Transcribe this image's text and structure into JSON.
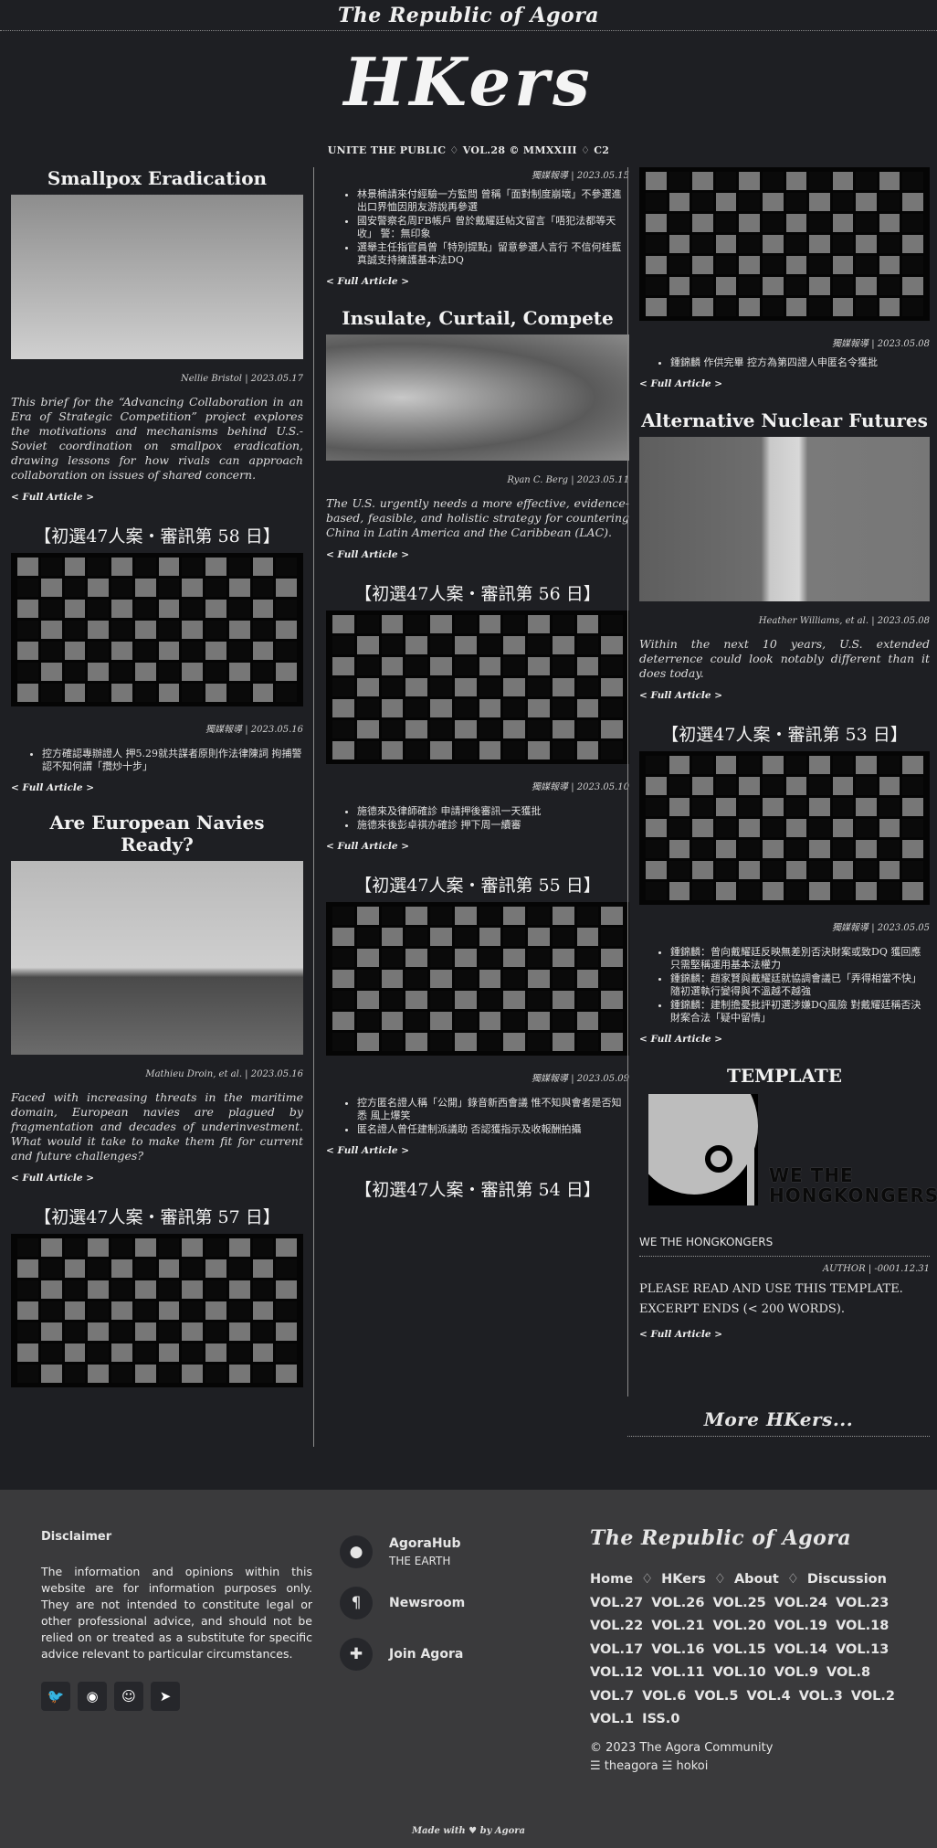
{
  "top_title": "The Republic of Agora",
  "masthead": {
    "logo": "HKers",
    "subtitle": "UNITE THE PUBLIC ♢ VOL.28 © MMXXIII ♢ C2"
  },
  "full_article": "< Full Article >",
  "col1": {
    "a1": {
      "title": "Smallpox Eradication",
      "byline": "Nellie Bristol | 2023.05.17",
      "lede": "This brief for the “Advancing Collaboration in an Era of Strategic Competition” project explores the motivations and mechanisms behind U.S.-Soviet coordination on smallpox eradication, drawing lessons for how rivals can approach collaboration on issues of shared concern."
    },
    "a2": {
      "title": "【初選47人案・審訊第 58 日】",
      "byline": "獨媒報導 | 2023.05.16",
      "bullets": [
        "控方確認專辦證人 押5.29就共謀者原則作法律陳詞 拘捕警認不知何謂「攬炒十步」"
      ]
    },
    "a3": {
      "title": "Are European Navies Ready?",
      "byline": "Mathieu Droin, et al. | 2023.05.16",
      "lede": "Faced with increasing threats in the maritime domain, European navies are plagued by fragmentation and decades of underinvestment. What would it take to make them fit for current and future challenges?"
    },
    "a4": {
      "title": "【初選47人案・審訊第 57 日】"
    }
  },
  "col2": {
    "top": {
      "byline": "獨媒報導 | 2023.05.15",
      "bullets": [
        "林景楠請來付經驗一方監問 曾稱「面對制度崩壞」不參選進出口界恤因朋友游說再參選",
        "國安警察名周FB帳戶 曾於戴耀廷帖文留言「唔犯法都等天收」 警：無印象",
        "選舉主任指官員曾「特別提點」留意參選人言行 不信何桂藍真誠支持擁護基本法DQ"
      ]
    },
    "a1": {
      "title": "Insulate, Curtail, Compete",
      "byline": "Ryan C. Berg | 2023.05.11",
      "lede": "The U.S. urgently needs a more effective, evidence-based, feasible, and holistic strategy for countering China in Latin America and the Caribbean (LAC)."
    },
    "a2": {
      "title": "【初選47人案・審訊第 56 日】",
      "byline": "獨媒報導 | 2023.05.10",
      "bullets": [
        "施德來及律師確診 申請押後審訊一天獲批",
        "施德來後彭卓祺亦確診 押下周一續審"
      ]
    },
    "a3": {
      "title": "【初選47人案・審訊第 55 日】",
      "byline": "獨媒報導 | 2023.05.09",
      "bullets": [
        "控方匿名證人稱「公開」錄音新西會議 惟不知與會者是否知悉 風上爆笑",
        "匿名證人曾任建制派議助 否認獲指示及收報酬拍攝"
      ]
    },
    "a4": {
      "title": "【初選47人案・審訊第 54 日】"
    }
  },
  "col3": {
    "top": {
      "byline": "獨媒報導 | 2023.05.08",
      "bullets": [
        "鍾錦麟 作供完畢 控方為第四證人申匿名令獲批"
      ]
    },
    "a1": {
      "title": "Alternative Nuclear Futures",
      "byline": "Heather Williams, et al. | 2023.05.08",
      "lede": "Within the next 10 years, U.S. extended deterrence could look notably different than it does today."
    },
    "a2": {
      "title": "【初選47人案・審訊第 53 日】",
      "byline": "獨媒報導 | 2023.05.05",
      "bullets": [
        "鍾錦麟：曾向戴耀廷反映無差別否決財案或致DQ 獲回應只需堅稱運用基本法權力",
        "鍾錦麟：趙家賢與戴耀廷就協調會議已「弄得相當不快」 隨初選執行變得與不溫越不越強",
        "鍾錦麟：建制擔憂批評初選涉嫌DQ風險 對戴耀廷稱否決財案合法「疑中留情」"
      ]
    },
    "a3": {
      "title": "TEMPLATE",
      "logo_text": "WE THE HONGKONGERS",
      "name": "WE THE HONGKONGERS",
      "byline": "AUTHOR | -0001.12.31",
      "body": "PLEASE READ AND USE THIS TEMPLATE. EXCERPT ENDS (< 200 WORDS)."
    },
    "more": "More HKers..."
  },
  "footer": {
    "disclaimer_title": "Disclaimer",
    "disclaimer": "The information and opinions within this website are for information purposes only. They are not intended to constitute legal or other professional advice, and should not be relied on or treated as a substitute for specific advice relevant to particular circumstances.",
    "social_icons": [
      "twitter-icon",
      "github-icon",
      "reddit-icon",
      "telegram-icon"
    ],
    "links": [
      {
        "title": "AgoraHub",
        "sub": "THE EARTH",
        "icon": "map-pin-icon"
      },
      {
        "title": "Newsroom",
        "sub": "",
        "icon": "paragraph-icon"
      },
      {
        "title": "Join Agora",
        "sub": "",
        "icon": "puzzle-icon"
      }
    ],
    "brand": "The Republic of Agora",
    "nav_rows": [
      "Home ♢ HKers ♢ About ♢ Discussion",
      "VOL.27  VOL.26  VOL.25  VOL.24  VOL.23",
      "VOL.22  VOL.21  VOL.20  VOL.19  VOL.18",
      "VOL.17  VOL.16  VOL.15  VOL.14  VOL.13",
      "VOL.12   VOL.11   VOL.10   VOL.9   VOL.8",
      "VOL.7  VOL.6  VOL.5  VOL.4  VOL.3  VOL.2",
      "VOL.1 ISS.0"
    ],
    "copyright": "© 2023 The Agora Community",
    "handles": "☰ theagora ☱ hokoi",
    "made": "Made with ♥ by Agora"
  }
}
